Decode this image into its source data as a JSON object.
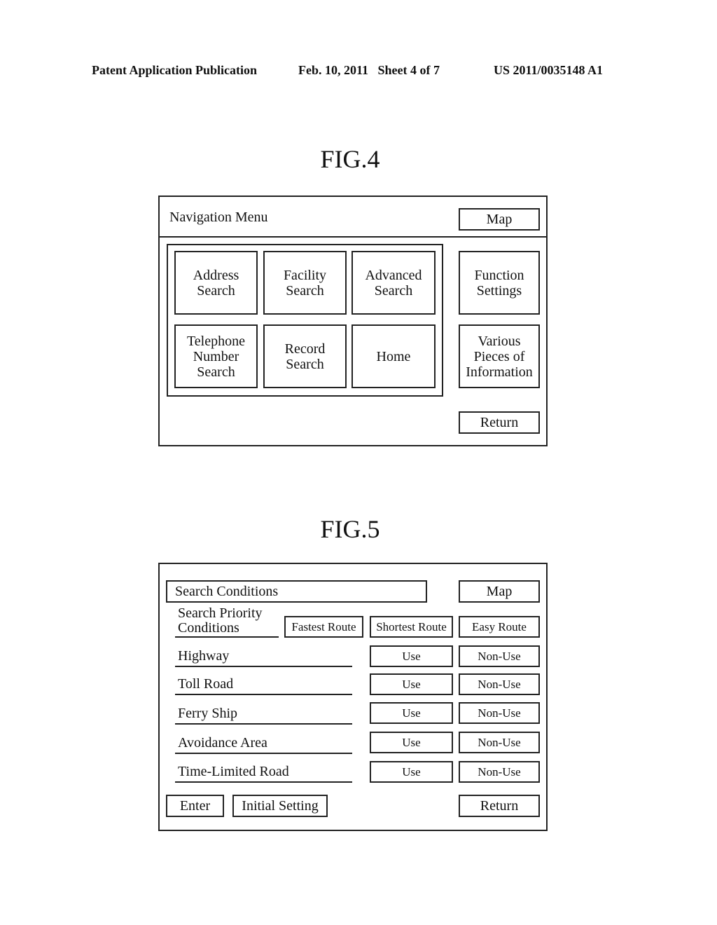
{
  "header": {
    "publication": "Patent Application Publication",
    "date_sheet": "Feb. 10, 2011   Sheet 4 of 7",
    "number": "US 2011/0035148 A1"
  },
  "fig4": {
    "label": "FIG.4",
    "title": "Navigation Menu",
    "map_button": "Map",
    "grid_buttons": [
      {
        "line1": "Address",
        "line2": "Search",
        "line3": ""
      },
      {
        "line1": "Facility",
        "line2": "Search",
        "line3": ""
      },
      {
        "line1": "Advanced",
        "line2": "Search",
        "line3": ""
      },
      {
        "line1": "Telephone",
        "line2": "Number",
        "line3": "Search"
      },
      {
        "line1": "Record",
        "line2": "Search",
        "line3": ""
      },
      {
        "line1": "Home",
        "line2": "",
        "line3": ""
      }
    ],
    "side_buttons": [
      {
        "line1": "Function",
        "line2": "Settings",
        "line3": ""
      },
      {
        "line1": "Various",
        "line2": "Pieces of",
        "line3": "Information"
      }
    ],
    "return_button": "Return"
  },
  "fig5": {
    "label": "FIG.5",
    "title": "Search Conditions",
    "map_button": "Map",
    "priority": {
      "label_line1": "Search Priority",
      "label_line2": "Conditions",
      "options": [
        "Fastest Route",
        "Shortest Route",
        "Easy Route"
      ]
    },
    "rows": [
      {
        "label": "Highway",
        "use": "Use",
        "nonuse": "Non-Use"
      },
      {
        "label": "Toll Road",
        "use": "Use",
        "nonuse": "Non-Use"
      },
      {
        "label": "Ferry Ship",
        "use": "Use",
        "nonuse": "Non-Use"
      },
      {
        "label": "Avoidance Area",
        "use": "Use",
        "nonuse": "Non-Use"
      },
      {
        "label": "Time-Limited Road",
        "use": "Use",
        "nonuse": "Non-Use"
      }
    ],
    "enter_button": "Enter",
    "initial_setting_button": "Initial Setting",
    "return_button": "Return"
  }
}
